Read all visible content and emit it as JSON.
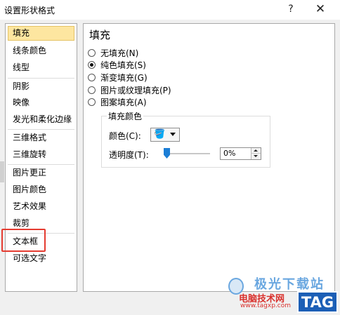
{
  "window": {
    "title": "设置形状格式",
    "help_glyph": "?",
    "close_glyph": "✕"
  },
  "nav": {
    "items": [
      "填充",
      "线条颜色",
      "线型",
      "阴影",
      "映像",
      "发光和柔化边缘",
      "三维格式",
      "三维旋转",
      "图片更正",
      "图片颜色",
      "艺术效果",
      "裁剪",
      "文本框",
      "可选文字"
    ],
    "selected": "填充",
    "highlighted": "文本框"
  },
  "fill": {
    "heading": "填充",
    "options": [
      "无填充(N)",
      "纯色填充(S)",
      "渐变填充(G)",
      "图片或纹理填充(P)",
      "图案填充(A)"
    ],
    "selected": "纯色填充(S)",
    "group_title": "填充颜色",
    "color_label": "颜色(C):",
    "transparency_label": "透明度(T):",
    "transparency_value": "0%",
    "transparency_level": 0
  },
  "colors": {
    "highlight": "#e53b30",
    "selected_nav": "#fde6a0",
    "slider_thumb": "#1c7ed6"
  },
  "icons": {
    "color_picker": "paint-bucket-icon",
    "dropdown": "chevron-down-icon"
  },
  "watermark": {
    "brand": "极光下载站",
    "site": "电脑技术网",
    "url": "www.tagxp.com",
    "tag": "TAG"
  }
}
